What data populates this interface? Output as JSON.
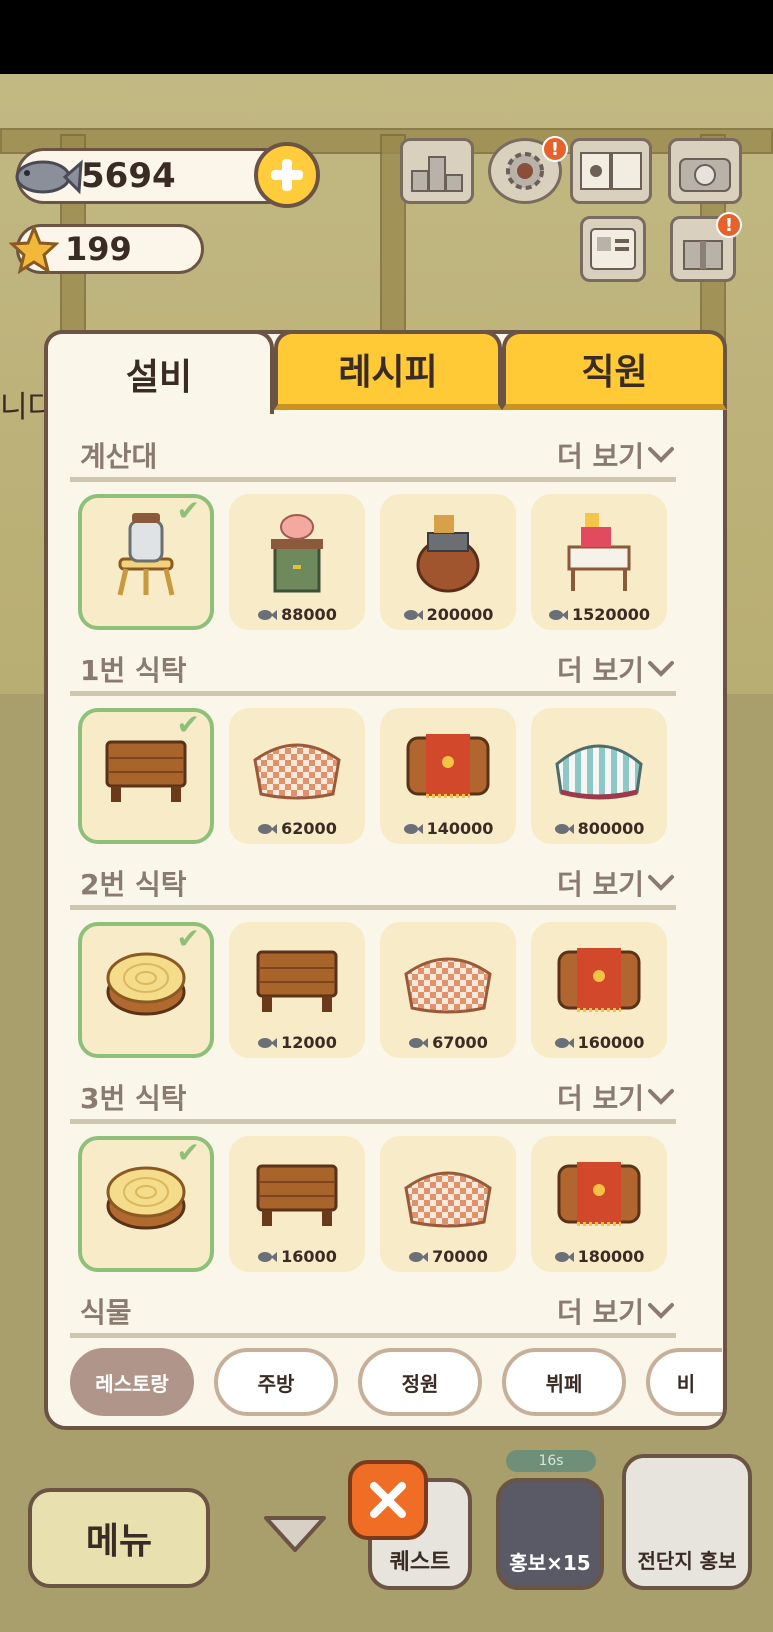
{
  "currency": {
    "fish": "5694",
    "stars": "199"
  },
  "hud": {
    "side_text": "니다"
  },
  "tabs": [
    {
      "label": "설비",
      "active": true
    },
    {
      "label": "레시피",
      "active": false
    },
    {
      "label": "직원",
      "active": false
    }
  ],
  "more_label": "더 보기",
  "sections": [
    {
      "title": "계산대",
      "items": [
        {
          "owned": true,
          "price": "",
          "art": "jar-stool"
        },
        {
          "owned": false,
          "price": "88000",
          "art": "piggy-bank-cabinet"
        },
        {
          "owned": false,
          "price": "200000",
          "art": "cash-register-wood"
        },
        {
          "owned": false,
          "price": "1520000",
          "art": "cash-register-white"
        }
      ]
    },
    {
      "title": "1번 식탁",
      "items": [
        {
          "owned": true,
          "price": "",
          "art": "wood-table"
        },
        {
          "owned": false,
          "price": "62000",
          "art": "checkered-table"
        },
        {
          "owned": false,
          "price": "140000",
          "art": "paw-cloth-table"
        },
        {
          "owned": false,
          "price": "800000",
          "art": "striped-table"
        }
      ]
    },
    {
      "title": "2번 식탁",
      "items": [
        {
          "owned": true,
          "price": "",
          "art": "stump-table"
        },
        {
          "owned": false,
          "price": "12000",
          "art": "wood-table"
        },
        {
          "owned": false,
          "price": "67000",
          "art": "checkered-table"
        },
        {
          "owned": false,
          "price": "160000",
          "art": "paw-cloth-table"
        }
      ]
    },
    {
      "title": "3번 식탁",
      "items": [
        {
          "owned": true,
          "price": "",
          "art": "stump-table"
        },
        {
          "owned": false,
          "price": "16000",
          "art": "wood-table"
        },
        {
          "owned": false,
          "price": "70000",
          "art": "checkered-table"
        },
        {
          "owned": false,
          "price": "180000",
          "art": "paw-cloth-table"
        }
      ]
    },
    {
      "title": "식물",
      "items": []
    }
  ],
  "categories": [
    {
      "label": "레스토랑",
      "active": true
    },
    {
      "label": "주방",
      "active": false
    },
    {
      "label": "정원",
      "active": false
    },
    {
      "label": "뷔페",
      "active": false
    },
    {
      "label": "비",
      "active": false
    }
  ],
  "bottom": {
    "menu": "메뉴",
    "quest": "퀘스트",
    "promo": "홍보×15",
    "flyer": "전단지 홍보",
    "timer": "16s"
  },
  "colors": {
    "accent": "#ffca35",
    "owned_border": "#8ec07a",
    "close": "#ef6d24",
    "panel": "#fbf6ea"
  }
}
